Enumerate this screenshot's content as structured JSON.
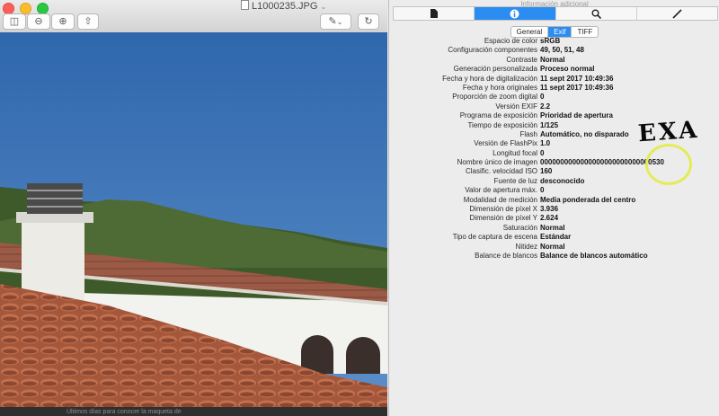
{
  "preview": {
    "title": "L1000235.JPG",
    "footer_text": "Últimos días para conocer la maqueta de"
  },
  "inspector": {
    "title": "Información adicional",
    "tabs": [
      "document-icon",
      "info-icon",
      "search-icon",
      "pen-icon"
    ],
    "active_tab": 1,
    "segments": [
      {
        "label": "General",
        "active": false
      },
      {
        "label": "Exif",
        "active": true
      },
      {
        "label": "TIFF",
        "active": false
      }
    ],
    "rows": [
      {
        "label": "Espacio de color",
        "value": "sRGB"
      },
      {
        "label": "Configuración componentes",
        "value": "49, 50, 51, 48"
      },
      {
        "label": "Contraste",
        "value": "Normal"
      },
      {
        "label": "Generación personalizada",
        "value": "Proceso normal"
      },
      {
        "label": "Fecha y hora de digitalización",
        "value": "11 sept 2017 10:49:36"
      },
      {
        "label": "Fecha y hora originales",
        "value": "11 sept 2017 10:49:36"
      },
      {
        "label": "Proporción de zoom digital",
        "value": "0"
      },
      {
        "label": "Versión EXIF",
        "value": "2.2"
      },
      {
        "label": "Programa de exposición",
        "value": "Prioridad de apertura"
      },
      {
        "label": "Tiempo de exposición",
        "value": "1/125"
      },
      {
        "label": "Flash",
        "value": "Automático, no disparado"
      },
      {
        "label": "Versión de FlashPix",
        "value": "1.0"
      },
      {
        "label": "Longitud focal",
        "value": "0"
      },
      {
        "label": "Nombre único de imagen",
        "value": "0000000000000000000000000000530"
      },
      {
        "label": "Clasific. velocidad ISO",
        "value": "160"
      },
      {
        "label": "Fuente de luz",
        "value": "desconocido"
      },
      {
        "label": "Valor de apertura máx.",
        "value": "0"
      },
      {
        "label": "Modalidad de medición",
        "value": "Media ponderada del centro"
      },
      {
        "label": "Dimensión de píxel X",
        "value": "3.936"
      },
      {
        "label": "Dimensión de píxel Y",
        "value": "2.624"
      },
      {
        "label": "Saturación",
        "value": "Normal"
      },
      {
        "label": "Tipo de captura de escena",
        "value": "Estándar"
      },
      {
        "label": "Nitidez",
        "value": "Normal"
      },
      {
        "label": "Balance de blancos",
        "value": "Balance de blancos automático"
      }
    ]
  },
  "annotation": {
    "text": "EXA"
  },
  "colors": {
    "accent": "#2b8cf2",
    "highlight_circle": "#e3ec56",
    "sky": "#3f78b6",
    "roof_tiles": "#a5573b"
  }
}
